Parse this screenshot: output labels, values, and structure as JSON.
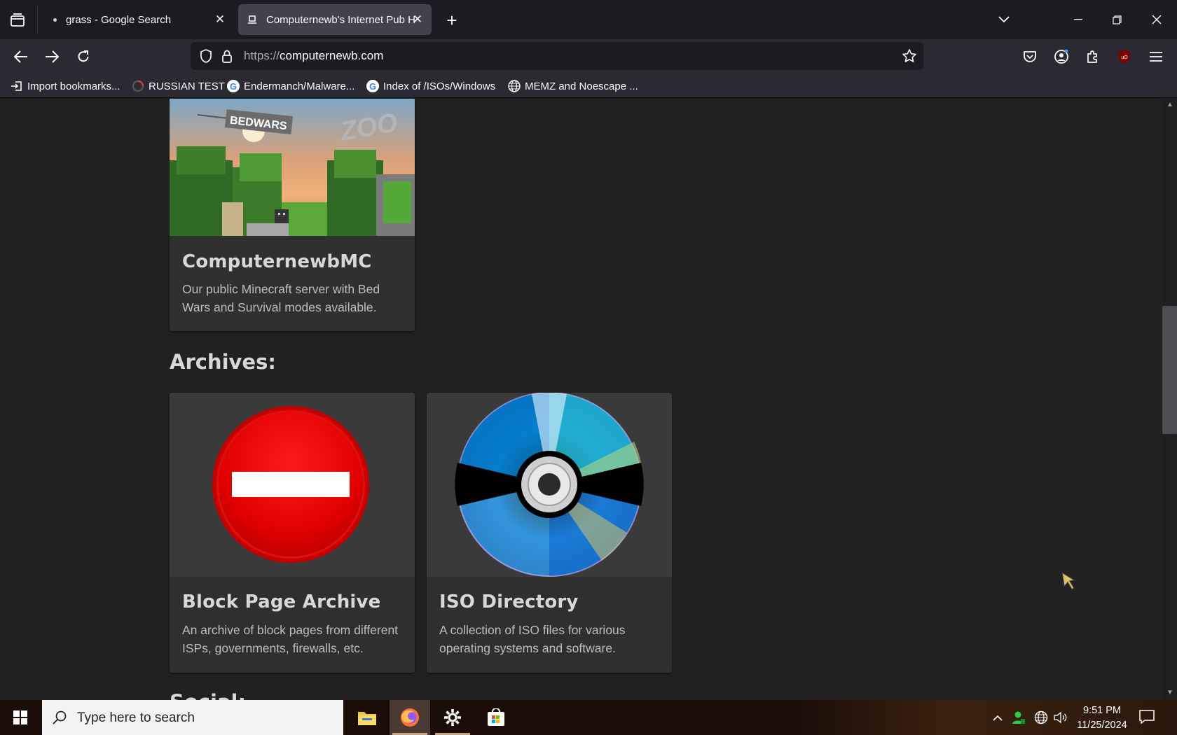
{
  "browser": {
    "tabs": [
      {
        "title": "grass - Google Search",
        "active": false
      },
      {
        "title": "Computernewb's Internet Pub H",
        "active": true
      }
    ],
    "url": {
      "scheme": "https://",
      "host": "computernewb.com"
    },
    "bookmarks": [
      {
        "label": "Import bookmarks...",
        "icon": "import-icon"
      },
      {
        "label": "RUSSIAN TEST",
        "icon": "loading-icon"
      },
      {
        "label": "Endermanch/Malware...",
        "icon": "google-icon"
      },
      {
        "label": "Index of /ISOs/Windows",
        "icon": "google-icon"
      },
      {
        "label": "MEMZ and Noescape ...",
        "icon": "globe-icon"
      }
    ],
    "extension_badge": "uO"
  },
  "page": {
    "cards_top": [
      {
        "title": "ComputernewbMC",
        "description": "Our public Minecraft server with Bed Wars and Survival modes available.",
        "image_text": [
          "BEDWARS",
          "ZOO"
        ]
      }
    ],
    "archives_heading": "Archives:",
    "archive_cards": [
      {
        "title": "Block Page Archive",
        "description": "An archive of block pages from different ISPs, governments, firewalls, etc.",
        "image": "no-entry-sign"
      },
      {
        "title": "ISO Directory",
        "description": "A collection of ISO files for various operating systems and software.",
        "image": "disc"
      }
    ],
    "next_heading_partial": "Social:"
  },
  "taskbar": {
    "search_placeholder": "Type here to search",
    "time": "9:51 PM",
    "date": "11/25/2024",
    "apps": [
      "file-explorer-icon",
      "firefox-icon",
      "settings-icon",
      "store-icon"
    ]
  }
}
